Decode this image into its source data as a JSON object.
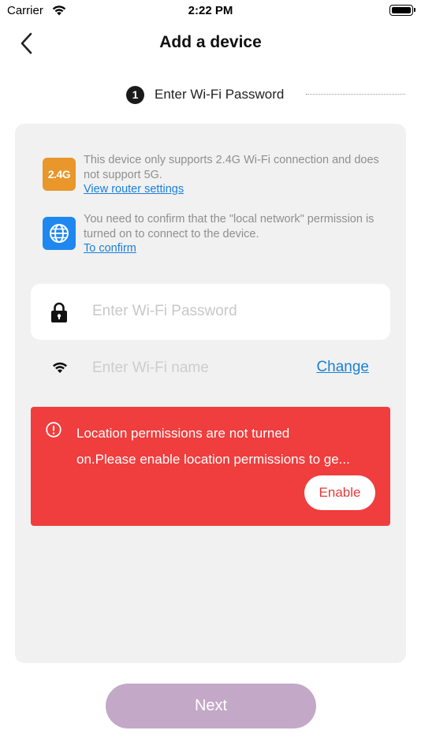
{
  "status_bar": {
    "carrier": "Carrier",
    "time": "2:22 PM"
  },
  "nav": {
    "title": "Add a device"
  },
  "step": {
    "number": "1",
    "label": "Enter Wi-Fi Password"
  },
  "notices": [
    {
      "icon": "2.4g-badge-icon",
      "badge_text": "2.4G",
      "text": "This device only supports 2.4G Wi-Fi connection and does not support 5G.",
      "link": "View router settings",
      "color": "#e9962a"
    },
    {
      "icon": "globe-icon",
      "text": "You need to confirm that the \"local network\" permission is turned on to connect to the device.",
      "link": "To confirm",
      "color": "#1f88f0"
    }
  ],
  "password_field": {
    "placeholder": "Enter Wi-Fi Password",
    "value": ""
  },
  "wifi_name_field": {
    "placeholder": "Enter Wi-Fi name",
    "value": "",
    "change_label": "Change"
  },
  "alert": {
    "line1": "Location permissions are not turned",
    "line2": "on.Please enable location permissions to ge...",
    "button_label": "Enable",
    "color": "#f03d3d"
  },
  "footer": {
    "next_label": "Next",
    "color": "#c4a8c8"
  }
}
